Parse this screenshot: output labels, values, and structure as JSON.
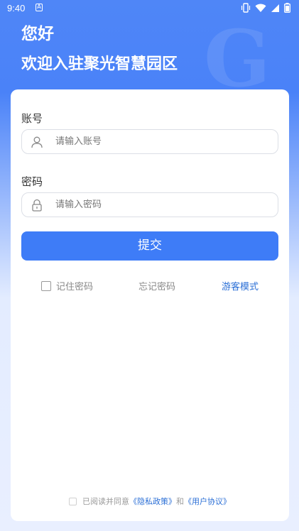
{
  "status_bar": {
    "time": "9:40",
    "notification_icon": "A",
    "icons": [
      "vibrate-icon",
      "wifi-icon",
      "signal-icon",
      "battery-icon"
    ]
  },
  "header": {
    "greeting": "您好",
    "welcome": "欢迎入驻聚光智慧园区"
  },
  "form": {
    "account_label": "账号",
    "account_placeholder": "请输入账号",
    "password_label": "密码",
    "password_placeholder": "请输入密码",
    "submit_label": "提交",
    "remember_label": "记住密码",
    "forgot_label": "忘记密码",
    "guest_label": "游客模式"
  },
  "agreement": {
    "prefix": "已阅读并同意",
    "privacy_link": "《隐私政策》",
    "and": "和",
    "terms_link": "《用户协议》"
  },
  "colors": {
    "primary": "#3e7cf7",
    "link": "#2b6fd6",
    "header_bg": "#4f86f7"
  }
}
